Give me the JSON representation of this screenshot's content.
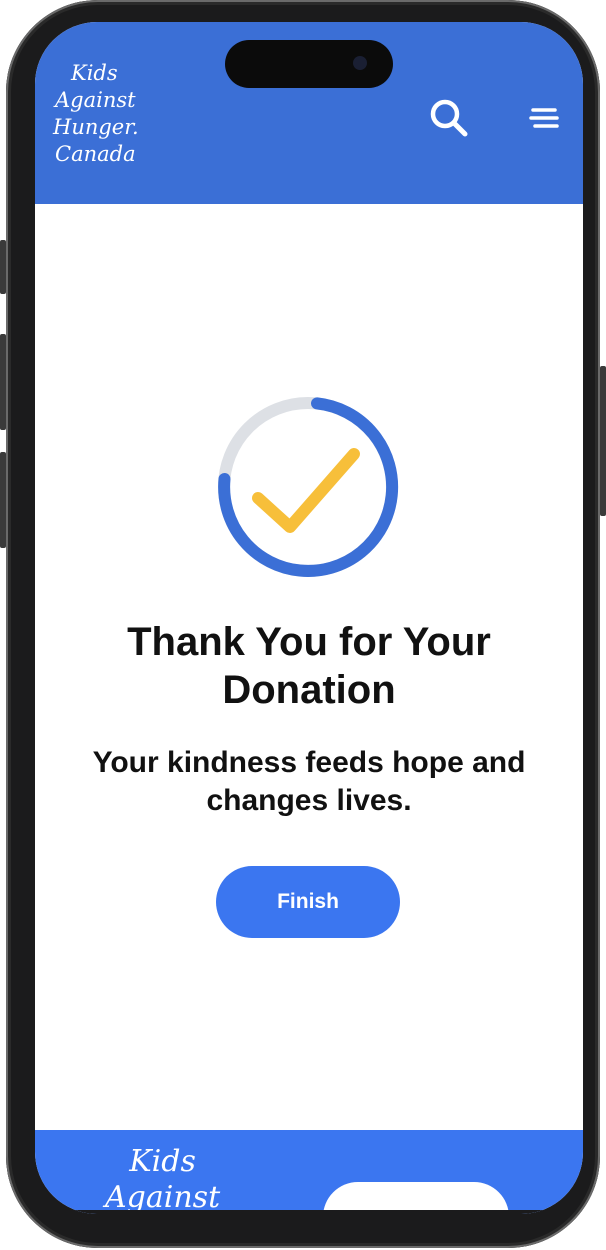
{
  "brand": {
    "logo_lines": [
      "Kids",
      "Against",
      "Hunger.",
      "Canada"
    ]
  },
  "header": {
    "search_icon": "search-icon",
    "menu_icon": "menu-icon"
  },
  "main": {
    "success_icon": "check-circle-icon",
    "title": "Thank You for Your Donation",
    "subtitle": "Your kindness feeds hope and changes lives.",
    "finish_label": "Finish"
  },
  "footer": {
    "logo_lines": [
      "Kids",
      "Against"
    ]
  },
  "colors": {
    "header_blue": "#3b6fd6",
    "button_blue": "#3b76f0",
    "check_yellow": "#f7bf3a",
    "ring_grey": "#dde0e5"
  }
}
